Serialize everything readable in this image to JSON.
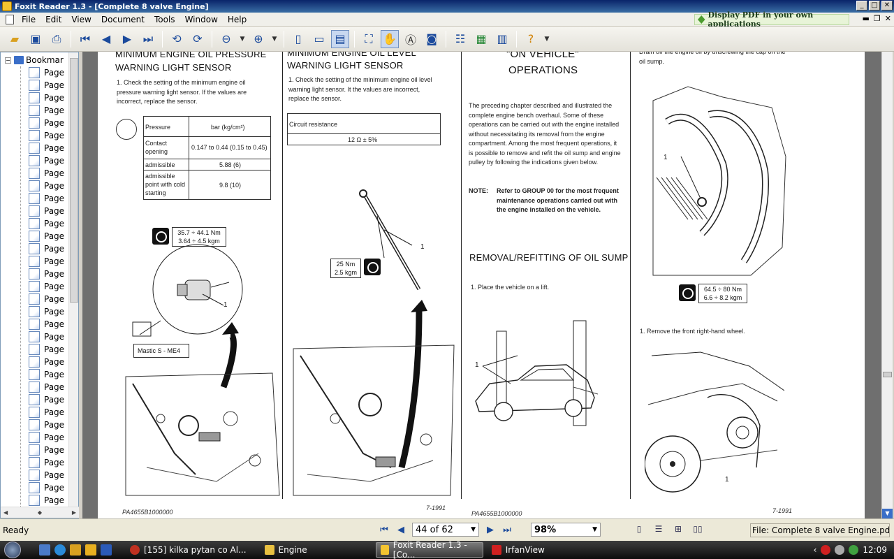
{
  "window": {
    "title": "Foxit Reader 1.3 - [Complete 8 valve Engine]",
    "minimize": "_",
    "maximize": "□",
    "close": "✕"
  },
  "menu": [
    "File",
    "Edit",
    "View",
    "Document",
    "Tools",
    "Window",
    "Help"
  ],
  "promo": "Display PDF in your own applications",
  "mdi": {
    "min": "▬",
    "restore": "❐",
    "close": "✕"
  },
  "toolbar": {
    "icons": [
      "open-icon",
      "save-icon",
      "print-icon",
      "first-page-icon",
      "prev-page-icon",
      "next-page-icon",
      "last-page-icon",
      "rotate-left-icon",
      "rotate-right-icon",
      "zoom-out-icon",
      "zoom-in-icon",
      "actual-size-icon",
      "fit-page-icon",
      "fit-width-icon",
      "find-icon",
      "hand-icon",
      "select-text-icon",
      "snapshot-icon",
      "bookmark-panel-icon",
      "thumbnail-icon",
      "layers-icon",
      "help-icon"
    ]
  },
  "bookmarks": {
    "root": "Bookmar",
    "pages": [
      "Page",
      "Page",
      "Page",
      "Page",
      "Page",
      "Page",
      "Page",
      "Page",
      "Page",
      "Page",
      "Page",
      "Page",
      "Page",
      "Page",
      "Page",
      "Page",
      "Page",
      "Page",
      "Page",
      "Page",
      "Page",
      "Page",
      "Page",
      "Page",
      "Page",
      "Page",
      "Page",
      "Page",
      "Page",
      "Page",
      "Page",
      "Page",
      "Page",
      "Page",
      "Page",
      "Page",
      "Page"
    ]
  },
  "doc": {
    "col1": {
      "heading1": "MINIMUM ENGINE OIL PRESSURE",
      "heading2": "WARNING LIGHT SENSOR",
      "step1": "1.  Check the setting of the minimum engine oil pressure warning light sensor. If the values are incorrect, replace the sensor.",
      "table": {
        "h1": "Pressure",
        "h2": "bar (kg/cm²)",
        "r1a": "Contact opening",
        "r1b": "0.147 to 0.44 (0.15 to 0.45)",
        "r2a": "admissible",
        "r2b": "5.88 (6)",
        "r3a": "admissible point with cold starting",
        "r3b": "9.8 (10)"
      },
      "torque1": "35.7 ÷ 44.1 Nm",
      "torque2": "3.64 ÷ 4.5 kgm",
      "callout": "1",
      "mastic": "Mastic   S - ME4",
      "footer_left": "PA4655B1000000",
      "footer_right": "7-1991"
    },
    "col2": {
      "heading1": "MINIMUM ENGINE OIL LEVEL",
      "heading2": "WARNING LIGHT SENSOR",
      "step1": "1.  Check the setting of the minimum engine oil level warning light sensor. It the values are incorrect, replace the sensor.",
      "table_h": "Circuit resistance",
      "table_v": "12 Ω ± 5%",
      "torque1": "25 Nm",
      "torque2": "2.5 kgm",
      "callout": "1"
    },
    "col3": {
      "heading1": "\"ON VEHICLE\"",
      "heading2": "OPERATIONS",
      "para": "The preceding chapter described and illustrated the complete engine bench overhaul. Some of these operations can be carried out with the engine installed without necessitating its removal from the engine compartment. Among the most frequent operations, it is possible to remove and refit the oil sump and engine pulley by following the indications given below.",
      "note_label": "NOTE:",
      "note": "Refer to GROUP 00 for the most frequent maintenance operations carried out with the engine installed on the vehicle.",
      "section": "REMOVAL/REFITTING OF OIL SUMP",
      "step1": "1.  Place the vehicle on a lift.",
      "callout": "1",
      "footer_left": "PA4655B1000000"
    },
    "col4": {
      "intro": "Drain off the engine oil by unscrewing the cap on the oil sump.",
      "torque1": "64.5 ÷ 80 Nm",
      "torque2": "6.6 ÷ 8.2 kgm",
      "callout": "1",
      "step1": "1.  Remove the front right-hand wheel.",
      "callout2": "1",
      "footer_right": "7-1991"
    }
  },
  "status": {
    "ready": "Ready",
    "page": "44 of 62",
    "zoom": "98%",
    "file": "File: Complete 8 valve Engine.pdf"
  },
  "taskbar": {
    "tasks": [
      {
        "label": "[155] kilka pytan co Al...",
        "color": "#c03020"
      },
      {
        "label": "Engine",
        "color": "#e8c040"
      },
      {
        "label": "Foxit Reader 1.3 - [Co...",
        "color": "#f4c430"
      },
      {
        "label": "IrfanView",
        "color": "#d02020"
      }
    ],
    "clock": "12:09"
  }
}
